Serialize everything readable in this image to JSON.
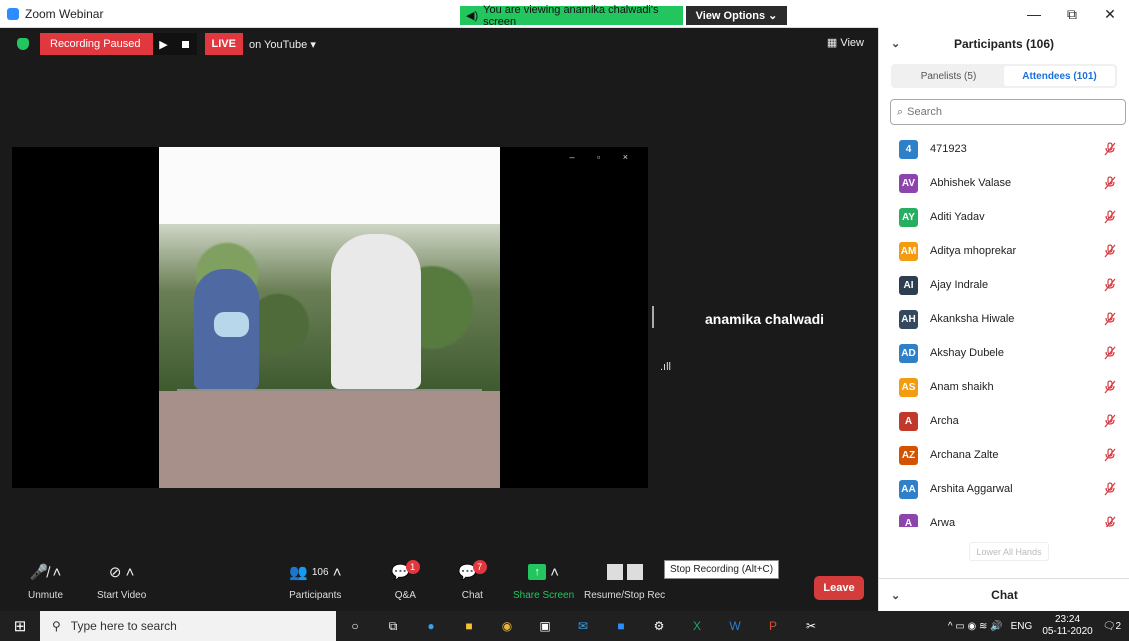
{
  "app": {
    "title": "Zoom Webinar"
  },
  "share_banner": "You are viewing anamika chalwadi's screen",
  "view_options": "View Options ⌄",
  "window_controls": {
    "minimize": "—",
    "maximize": "⧉",
    "close": "✕"
  },
  "recording": {
    "status": "Recording Paused",
    "live": "LIVE",
    "destination": "on YouTube ▾"
  },
  "view_button": "View",
  "speaker": {
    "name": "anamika chalwadi",
    "signal": ".ıll"
  },
  "toolbar": {
    "unmute": "Unmute",
    "start_video": "Start Video",
    "participants": "Participants",
    "participants_count": "106",
    "qa": "Q&A",
    "qa_badge": "1",
    "chat": "Chat",
    "chat_badge": "7",
    "share_screen": "Share Screen",
    "record": "Resume/Stop Rec",
    "leave": "Leave"
  },
  "tooltip": "Stop Recording (Alt+C)",
  "panel": {
    "title": "Participants (106)",
    "tabs": [
      "Panelists (5)",
      "Attendees (101)"
    ],
    "search_placeholder": "Search",
    "participants": [
      {
        "initials": "4",
        "name": "471923",
        "color": "#2f80c8"
      },
      {
        "initials": "AV",
        "name": "Abhishek Valase",
        "color": "#8e44ad"
      },
      {
        "initials": "AY",
        "name": "Aditi Yadav",
        "color": "#27ae60"
      },
      {
        "initials": "AM",
        "name": "Aditya mhoprekar",
        "color": "#f39c12"
      },
      {
        "initials": "AI",
        "name": "Ajay Indrale",
        "color": "#2c3e50"
      },
      {
        "initials": "AH",
        "name": "Akanksha Hiwale",
        "color": "#34495e"
      },
      {
        "initials": "AD",
        "name": "Akshay Dubele",
        "color": "#2f80c8"
      },
      {
        "initials": "AS",
        "name": "Anam shaikh",
        "color": "#f39c12"
      },
      {
        "initials": "A",
        "name": "Archa",
        "color": "#c0392b"
      },
      {
        "initials": "AZ",
        "name": "Archana Zalte",
        "color": "#d35400"
      },
      {
        "initials": "AA",
        "name": "Arshita Aggarwal",
        "color": "#2f80c8"
      },
      {
        "initials": "A",
        "name": "Arwa",
        "color": "#8e44ad"
      }
    ],
    "lower_hands": "Lower All Hands",
    "chat_title": "Chat"
  },
  "taskbar": {
    "search_placeholder": "Type here to search",
    "lang": "ENG",
    "time": "23:24",
    "date": "05-11-2020",
    "notifications": "2"
  }
}
